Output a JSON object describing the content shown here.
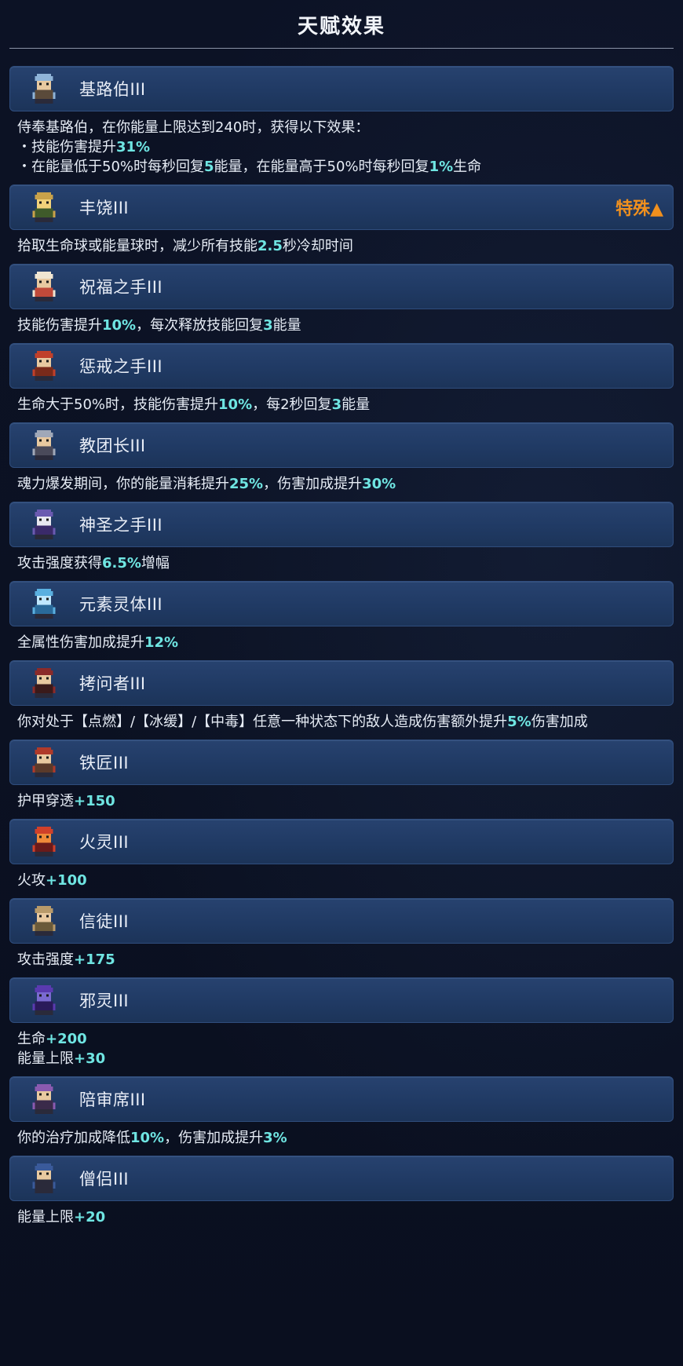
{
  "header": {
    "title": "天赋效果"
  },
  "talents": [
    {
      "name": "基路伯III",
      "icon": "cherub-avatar-icon",
      "lines": [
        [
          {
            "t": "侍奉基路伯，在你能量上限达到240时，获得以下效果："
          }
        ],
        [
          {
            "t": "・技能伤害提升"
          },
          {
            "t": "31%",
            "h": 1
          }
        ],
        [
          {
            "t": "・在能量低于50%时每秒回复"
          },
          {
            "t": "5",
            "h": 1
          },
          {
            "t": "能量，在能量高于50%时每秒回复"
          },
          {
            "t": "1%",
            "h": 1
          },
          {
            "t": "生命"
          }
        ]
      ]
    },
    {
      "name": "丰饶III",
      "icon": "abundance-avatar-icon",
      "badge": "特殊▲",
      "lines": [
        [
          {
            "t": "拾取生命球或能量球时，减少所有技能"
          },
          {
            "t": "2.5",
            "h": 1
          },
          {
            "t": "秒冷却时间"
          }
        ]
      ]
    },
    {
      "name": "祝福之手III",
      "icon": "blessing-hand-avatar-icon",
      "lines": [
        [
          {
            "t": "技能伤害提升"
          },
          {
            "t": "10%",
            "h": 1
          },
          {
            "t": "，每次释放技能回复"
          },
          {
            "t": "3",
            "h": 1
          },
          {
            "t": "能量"
          }
        ]
      ]
    },
    {
      "name": "惩戒之手III",
      "icon": "punishment-hand-avatar-icon",
      "lines": [
        [
          {
            "t": "生命大于50%时，技能伤害提升"
          },
          {
            "t": "10%",
            "h": 1
          },
          {
            "t": "，每2秒回复"
          },
          {
            "t": "3",
            "h": 1
          },
          {
            "t": "能量"
          }
        ]
      ]
    },
    {
      "name": "教团长III",
      "icon": "order-leader-avatar-icon",
      "lines": [
        [
          {
            "t": "魂力爆发期间，你的能量消耗提升"
          },
          {
            "t": "25%",
            "h": 1
          },
          {
            "t": "，伤害加成提升"
          },
          {
            "t": "30%",
            "h": 1
          }
        ]
      ]
    },
    {
      "name": "神圣之手III",
      "icon": "holy-hand-avatar-icon",
      "lines": [
        [
          {
            "t": "攻击强度获得"
          },
          {
            "t": "6.5%",
            "h": 1
          },
          {
            "t": "增幅"
          }
        ]
      ]
    },
    {
      "name": "元素灵体III",
      "icon": "elemental-spirit-avatar-icon",
      "lines": [
        [
          {
            "t": "全属性伤害加成提升"
          },
          {
            "t": "12%",
            "h": 1
          }
        ]
      ]
    },
    {
      "name": "拷问者III",
      "icon": "inquisitor-avatar-icon",
      "lines": [
        [
          {
            "t": "你对处于【点燃】/【冰缓】/【中毒】任意一种状态下的敌人造成伤害额外提升"
          },
          {
            "t": "5%",
            "h": 1
          },
          {
            "t": "伤害加成"
          }
        ]
      ]
    },
    {
      "name": "铁匠III",
      "icon": "blacksmith-avatar-icon",
      "lines": [
        [
          {
            "t": "护甲穿透"
          },
          {
            "t": "+150",
            "h": 1
          }
        ]
      ]
    },
    {
      "name": "火灵III",
      "icon": "fire-spirit-avatar-icon",
      "lines": [
        [
          {
            "t": "火攻"
          },
          {
            "t": "+100",
            "h": 1
          }
        ]
      ]
    },
    {
      "name": "信徒III",
      "icon": "believer-avatar-icon",
      "lines": [
        [
          {
            "t": "攻击强度"
          },
          {
            "t": "+175",
            "h": 1
          }
        ]
      ]
    },
    {
      "name": "邪灵III",
      "icon": "evil-spirit-avatar-icon",
      "lines": [
        [
          {
            "t": "生命"
          },
          {
            "t": "+200",
            "h": 1
          }
        ],
        [
          {
            "t": "能量上限"
          },
          {
            "t": "+30",
            "h": 1
          }
        ]
      ]
    },
    {
      "name": "陪审席III",
      "icon": "jury-avatar-icon",
      "lines": [
        [
          {
            "t": "你的治疗加成降低"
          },
          {
            "t": "10%",
            "h": 1
          },
          {
            "t": "，伤害加成提升"
          },
          {
            "t": "3%",
            "h": 1
          }
        ]
      ]
    },
    {
      "name": "僧侣III",
      "icon": "monk-avatar-icon",
      "lines": [
        [
          {
            "t": "能量上限"
          },
          {
            "t": "+20",
            "h": 1
          }
        ]
      ]
    }
  ],
  "colors": {
    "highlight": "#6fe5e2",
    "badge": "#f0901e",
    "bar": "#22406a"
  }
}
